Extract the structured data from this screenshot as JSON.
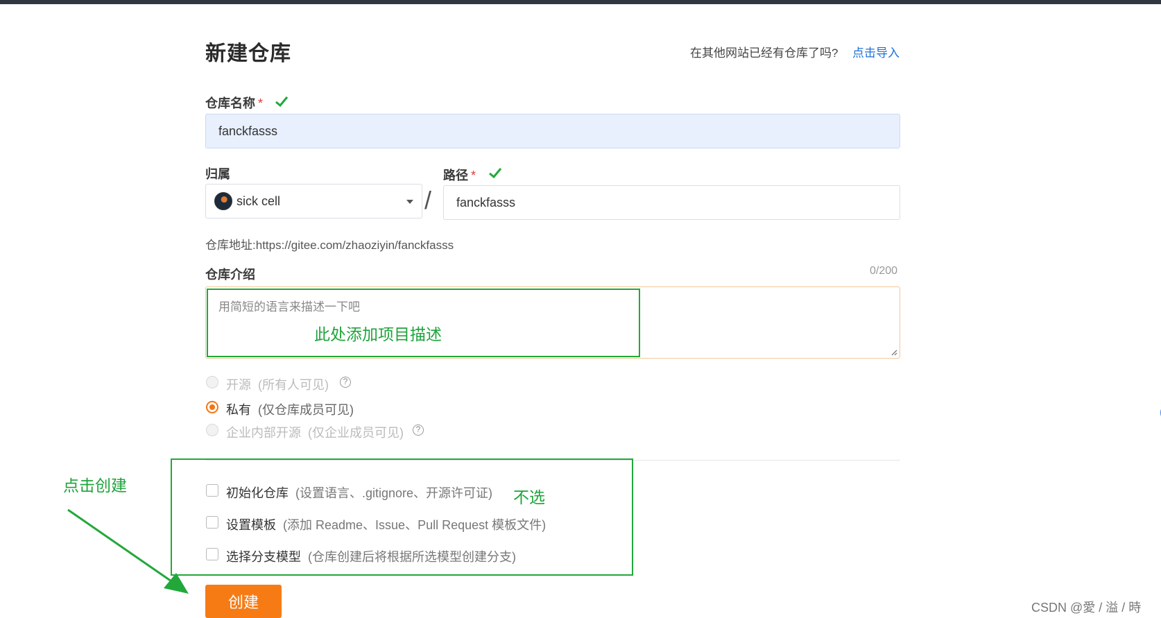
{
  "page": {
    "title": "新建仓库",
    "import_prompt": "在其他网站已经有仓库了吗?",
    "import_link": "点击导入"
  },
  "repo_name": {
    "label": "仓库名称",
    "required_mark": "*",
    "value": "fanckfasss"
  },
  "owner": {
    "label": "归属",
    "selected": "sick cell"
  },
  "separator": "/",
  "path": {
    "label": "路径",
    "required_mark": "*",
    "value": "fanckfasss"
  },
  "address": {
    "label": "仓库地址:",
    "url": "https://gitee.com/zhaoziyin/fanckfasss"
  },
  "description": {
    "label": "仓库介绍",
    "counter": "0/200",
    "placeholder": "用简短的语言来描述一下吧"
  },
  "visibility": {
    "options": [
      {
        "label": "开源",
        "hint": "(所有人可见)",
        "state": "disabled"
      },
      {
        "label": "私有",
        "hint": "(仅仓库成员可见)",
        "state": "checked"
      },
      {
        "label": "企业内部开源",
        "hint": "(仅企业成员可见)",
        "state": "disabled"
      }
    ],
    "help_glyph": "?"
  },
  "options": [
    {
      "label": "初始化仓库",
      "hint": "(设置语言、.gitignore、开源许可证)"
    },
    {
      "label": "设置模板",
      "hint": "(添加 Readme、Issue、Pull Request 模板文件)"
    },
    {
      "label": "选择分支模型",
      "hint": "(仓库创建后将根据所选模型创建分支)"
    }
  ],
  "create_button": "创建",
  "annotations": {
    "description_note": "此处添加项目描述",
    "options_note": "不选",
    "create_note": "点击创建",
    "color": "#1fa33b"
  },
  "watermark": "CSDN @愛 / 溢 / 時",
  "colors": {
    "accent": "#f77b14",
    "link": "#1e6fd9",
    "valid": "#22a83a"
  },
  "icons": {
    "valid": "check-icon",
    "dropdown": "chevron-down-icon",
    "help": "help-circle-icon",
    "resize": "resize-handle-icon",
    "arrow": "arrow-icon"
  }
}
